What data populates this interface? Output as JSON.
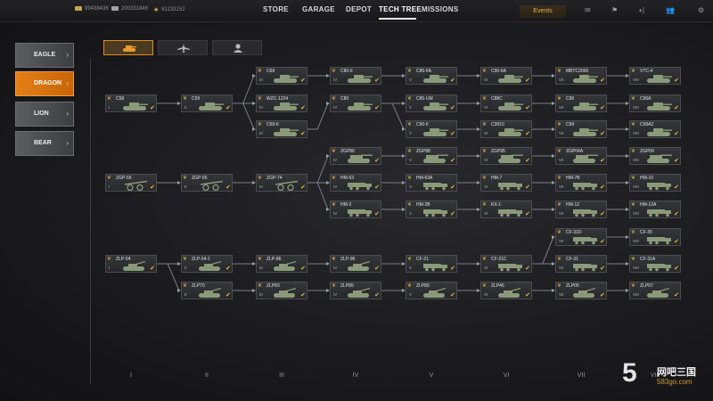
{
  "topbar": {
    "currencies": [
      {
        "icon": "gold-icon",
        "value": "99438436"
      },
      {
        "icon": "silver-icon",
        "value": "200331846"
      },
      {
        "icon": "star-icon",
        "value": "81133152"
      }
    ],
    "nav": [
      {
        "label": "STORE",
        "active": false
      },
      {
        "label": "GARAGE",
        "active": false
      },
      {
        "label": "DEPOT",
        "active": false
      },
      {
        "label": "TECH TREE",
        "active": true
      },
      {
        "label": "MISSIONS",
        "active": false
      }
    ],
    "events_label": "Events",
    "icons": [
      "mail-icon",
      "clan-icon",
      "sound-icon",
      "friends-icon",
      "settings-icon"
    ],
    "colors": {
      "accent": "#e57e16",
      "gold": "#e7b531"
    }
  },
  "factions": [
    {
      "label": "EAGLE",
      "active": false
    },
    {
      "label": "DRAGON",
      "active": true
    },
    {
      "label": "LION",
      "active": false
    },
    {
      "label": "BEAR",
      "active": false
    }
  ],
  "type_tabs": [
    {
      "icon": "tank-icon",
      "active": true
    },
    {
      "icon": "aircraft-icon",
      "active": false
    },
    {
      "icon": "infantry-icon",
      "active": false
    }
  ],
  "tiers": [
    "I",
    "II",
    "III",
    "IV",
    "V",
    "VI",
    "VII",
    "VIII"
  ],
  "vehicles": [
    {
      "id": "c58",
      "name": "C58",
      "tier": "I",
      "col": 0,
      "row": 1,
      "kind": "tank"
    },
    {
      "id": "c59",
      "name": "C59",
      "tier": "II",
      "col": 1,
      "row": 1,
      "kind": "tank"
    },
    {
      "id": "c69",
      "name": "C69",
      "tier": "III",
      "col": 2,
      "row": 0,
      "kind": "tank"
    },
    {
      "id": "wzc1224",
      "name": "WZC-1224",
      "tier": "III",
      "col": 2,
      "row": 1,
      "kind": "tank"
    },
    {
      "id": "c69ii",
      "name": "C69-II",
      "tier": "III",
      "col": 2,
      "row": 2,
      "kind": "tank"
    },
    {
      "id": "c80ii",
      "name": "C80-II",
      "tier": "IV",
      "col": 3,
      "row": 0,
      "kind": "tank"
    },
    {
      "id": "c80",
      "name": "C80",
      "tier": "IV",
      "col": 3,
      "row": 1,
      "kind": "tank"
    },
    {
      "id": "c85iia",
      "name": "C85-IIA",
      "tier": "V",
      "col": 4,
      "row": 0,
      "kind": "tank"
    },
    {
      "id": "c85um",
      "name": "C85-UM",
      "tier": "V",
      "col": 4,
      "row": 1,
      "kind": "tank"
    },
    {
      "id": "c90ii",
      "name": "C90-II",
      "tier": "V",
      "col": 4,
      "row": 2,
      "kind": "tank"
    },
    {
      "id": "c90iia",
      "name": "C90-IIA",
      "tier": "VI",
      "col": 5,
      "row": 0,
      "kind": "tank"
    },
    {
      "id": "c88c",
      "name": "C88C",
      "tier": "VI",
      "col": 5,
      "row": 1,
      "kind": "tank"
    },
    {
      "id": "c3910",
      "name": "C3910",
      "tier": "VI",
      "col": 5,
      "row": 2,
      "kind": "tank"
    },
    {
      "id": "mbtc2000",
      "name": "MBTC2000",
      "tier": "VII",
      "col": 6,
      "row": 0,
      "kind": "tank"
    },
    {
      "id": "c96",
      "name": "C96",
      "tier": "VII",
      "col": 6,
      "row": 1,
      "kind": "tank"
    },
    {
      "id": "c99",
      "name": "C99",
      "tier": "VII",
      "col": 6,
      "row": 2,
      "kind": "tank"
    },
    {
      "id": "vtc4",
      "name": "VTC-4",
      "tier": "VIII",
      "col": 7,
      "row": 0,
      "kind": "tank"
    },
    {
      "id": "c96a",
      "name": "C96A",
      "tier": "VIII",
      "col": 7,
      "row": 1,
      "kind": "tank"
    },
    {
      "id": "c99a2",
      "name": "C99A2",
      "tier": "VIII",
      "col": 7,
      "row": 2,
      "kind": "tank"
    },
    {
      "id": "zgp80",
      "name": "ZGP80",
      "tier": "IV",
      "col": 3,
      "row": 3,
      "kind": "spg"
    },
    {
      "id": "zgp88",
      "name": "ZGP88",
      "tier": "V",
      "col": 4,
      "row": 3,
      "kind": "spg"
    },
    {
      "id": "zgp95",
      "name": "ZGP95",
      "tier": "VI",
      "col": 5,
      "row": 3,
      "kind": "spg"
    },
    {
      "id": "zgp04a",
      "name": "ZGP04A",
      "tier": "VII",
      "col": 6,
      "row": 3,
      "kind": "spg"
    },
    {
      "id": "zgp09",
      "name": "ZGP09",
      "tier": "VIII",
      "col": 7,
      "row": 3,
      "kind": "spg"
    },
    {
      "id": "zgp55",
      "name": "ZGP-55",
      "tier": "I",
      "col": 0,
      "row": 4,
      "kind": "artillery"
    },
    {
      "id": "zgp65",
      "name": "ZGP-65",
      "tier": "II",
      "col": 1,
      "row": 4,
      "kind": "artillery"
    },
    {
      "id": "zgp74",
      "name": "ZGP-74",
      "tier": "III",
      "col": 2,
      "row": 4,
      "kind": "artillery"
    },
    {
      "id": "hm63",
      "name": "HM-63",
      "tier": "IV",
      "col": 3,
      "row": 4,
      "kind": "truck"
    },
    {
      "id": "hm63a",
      "name": "HM-63A",
      "tier": "V",
      "col": 4,
      "row": 4,
      "kind": "truck"
    },
    {
      "id": "hm7",
      "name": "HM-7",
      "tier": "VI",
      "col": 5,
      "row": 4,
      "kind": "truck"
    },
    {
      "id": "hm7b",
      "name": "HM-7B",
      "tier": "VII",
      "col": 6,
      "row": 4,
      "kind": "truck"
    },
    {
      "id": "hm10",
      "name": "HM-10",
      "tier": "VIII",
      "col": 7,
      "row": 4,
      "kind": "truck"
    },
    {
      "id": "hm2",
      "name": "HM-2",
      "tier": "IV",
      "col": 3,
      "row": 5,
      "kind": "truck"
    },
    {
      "id": "hm2b",
      "name": "HM-2B",
      "tier": "V",
      "col": 4,
      "row": 5,
      "kind": "truck"
    },
    {
      "id": "kx1",
      "name": "KX-1",
      "tier": "VI",
      "col": 5,
      "row": 5,
      "kind": "truck"
    },
    {
      "id": "hm12",
      "name": "HM-12",
      "tier": "VII",
      "col": 6,
      "row": 5,
      "kind": "truck"
    },
    {
      "id": "hm12a",
      "name": "HM-12A",
      "tier": "VIII",
      "col": 7,
      "row": 5,
      "kind": "truck"
    },
    {
      "id": "cf31d",
      "name": "CF-31D",
      "tier": "VII",
      "col": 6,
      "row": 6,
      "kind": "truck"
    },
    {
      "id": "cf35",
      "name": "CF-35",
      "tier": "VIII",
      "col": 7,
      "row": 6,
      "kind": "truck"
    },
    {
      "id": "zlp54",
      "name": "ZLP-54",
      "tier": "I",
      "col": 0,
      "row": 7,
      "kind": "aa"
    },
    {
      "id": "zlp541",
      "name": "ZLP-54-1",
      "tier": "II",
      "col": 1,
      "row": 7,
      "kind": "aa"
    },
    {
      "id": "zlp86",
      "name": "ZLP-86",
      "tier": "III",
      "col": 2,
      "row": 7,
      "kind": "aa"
    },
    {
      "id": "zlp96",
      "name": "ZLP-96",
      "tier": "IV",
      "col": 3,
      "row": 7,
      "kind": "aa"
    },
    {
      "id": "cf21",
      "name": "CF-21",
      "tier": "V",
      "col": 4,
      "row": 7,
      "kind": "truck"
    },
    {
      "id": "cf21c",
      "name": "CF-21C",
      "tier": "VI",
      "col": 5,
      "row": 7,
      "kind": "truck"
    },
    {
      "id": "cf31",
      "name": "CF-31",
      "tier": "VII",
      "col": 6,
      "row": 7,
      "kind": "truck"
    },
    {
      "id": "cf31a",
      "name": "CF-31A",
      "tier": "VIII",
      "col": 7,
      "row": 7,
      "kind": "truck"
    },
    {
      "id": "zlp70",
      "name": "ZLP70",
      "tier": "II",
      "col": 1,
      "row": 8,
      "kind": "aa"
    },
    {
      "id": "zlp83",
      "name": "ZLP83",
      "tier": "III",
      "col": 2,
      "row": 8,
      "kind": "aa"
    },
    {
      "id": "zlp85",
      "name": "ZLP85",
      "tier": "IV",
      "col": 3,
      "row": 8,
      "kind": "aa"
    },
    {
      "id": "zlp89",
      "name": "ZLP89",
      "tier": "V",
      "col": 4,
      "row": 8,
      "kind": "aa"
    },
    {
      "id": "zlp45",
      "name": "ZLP45",
      "tier": "VI",
      "col": 5,
      "row": 8,
      "kind": "aa"
    },
    {
      "id": "zlp05",
      "name": "ZLP05",
      "tier": "VII",
      "col": 6,
      "row": 8,
      "kind": "aa"
    },
    {
      "id": "zlp97",
      "name": "ZLP97",
      "tier": "VIII",
      "col": 7,
      "row": 8,
      "kind": "aa"
    }
  ],
  "links": [
    [
      "c58",
      "c59"
    ],
    [
      "c59",
      "c69"
    ],
    [
      "c59",
      "wzc1224"
    ],
    [
      "c59",
      "c69ii"
    ],
    [
      "c69",
      "c80ii"
    ],
    [
      "c69ii",
      "c80"
    ],
    [
      "c80ii",
      "c85iia"
    ],
    [
      "c80",
      "c85um"
    ],
    [
      "c80",
      "c90ii"
    ],
    [
      "c85iia",
      "c90iia"
    ],
    [
      "c85um",
      "c88c"
    ],
    [
      "c90ii",
      "c3910"
    ],
    [
      "c90iia",
      "mbtc2000"
    ],
    [
      "c88c",
      "c96"
    ],
    [
      "c3910",
      "c99"
    ],
    [
      "mbtc2000",
      "vtc4"
    ],
    [
      "c96",
      "c96a"
    ],
    [
      "c99",
      "c99a2"
    ],
    [
      "zgp55",
      "zgp65"
    ],
    [
      "zgp65",
      "zgp74"
    ],
    [
      "zgp74",
      "zgp80"
    ],
    [
      "zgp74",
      "hm63"
    ],
    [
      "zgp74",
      "hm2"
    ],
    [
      "zgp80",
      "zgp88"
    ],
    [
      "zgp88",
      "zgp95"
    ],
    [
      "zgp95",
      "zgp04a"
    ],
    [
      "zgp04a",
      "zgp09"
    ],
    [
      "hm63",
      "hm63a"
    ],
    [
      "hm63a",
      "hm7"
    ],
    [
      "hm7",
      "hm7b"
    ],
    [
      "hm7b",
      "hm10"
    ],
    [
      "hm2",
      "hm2b"
    ],
    [
      "hm2b",
      "kx1"
    ],
    [
      "kx1",
      "hm12"
    ],
    [
      "hm12",
      "hm12a"
    ],
    [
      "cf21c",
      "cf31d"
    ],
    [
      "cf31d",
      "cf35"
    ],
    [
      "zlp54",
      "zlp541"
    ],
    [
      "zlp54",
      "zlp70"
    ],
    [
      "zlp541",
      "zlp86"
    ],
    [
      "zlp70",
      "zlp83"
    ],
    [
      "zlp86",
      "zlp96"
    ],
    [
      "zlp83",
      "zlp85"
    ],
    [
      "zlp96",
      "cf21"
    ],
    [
      "zlp85",
      "zlp89"
    ],
    [
      "cf21",
      "cf21c"
    ],
    [
      "zlp89",
      "zlp45"
    ],
    [
      "cf21c",
      "cf31"
    ],
    [
      "zlp45",
      "zlp05"
    ],
    [
      "cf31",
      "cf31a"
    ],
    [
      "zlp05",
      "zlp97"
    ]
  ],
  "watermark": {
    "number": "5",
    "name": "网吧三国",
    "url": "583go.com"
  }
}
